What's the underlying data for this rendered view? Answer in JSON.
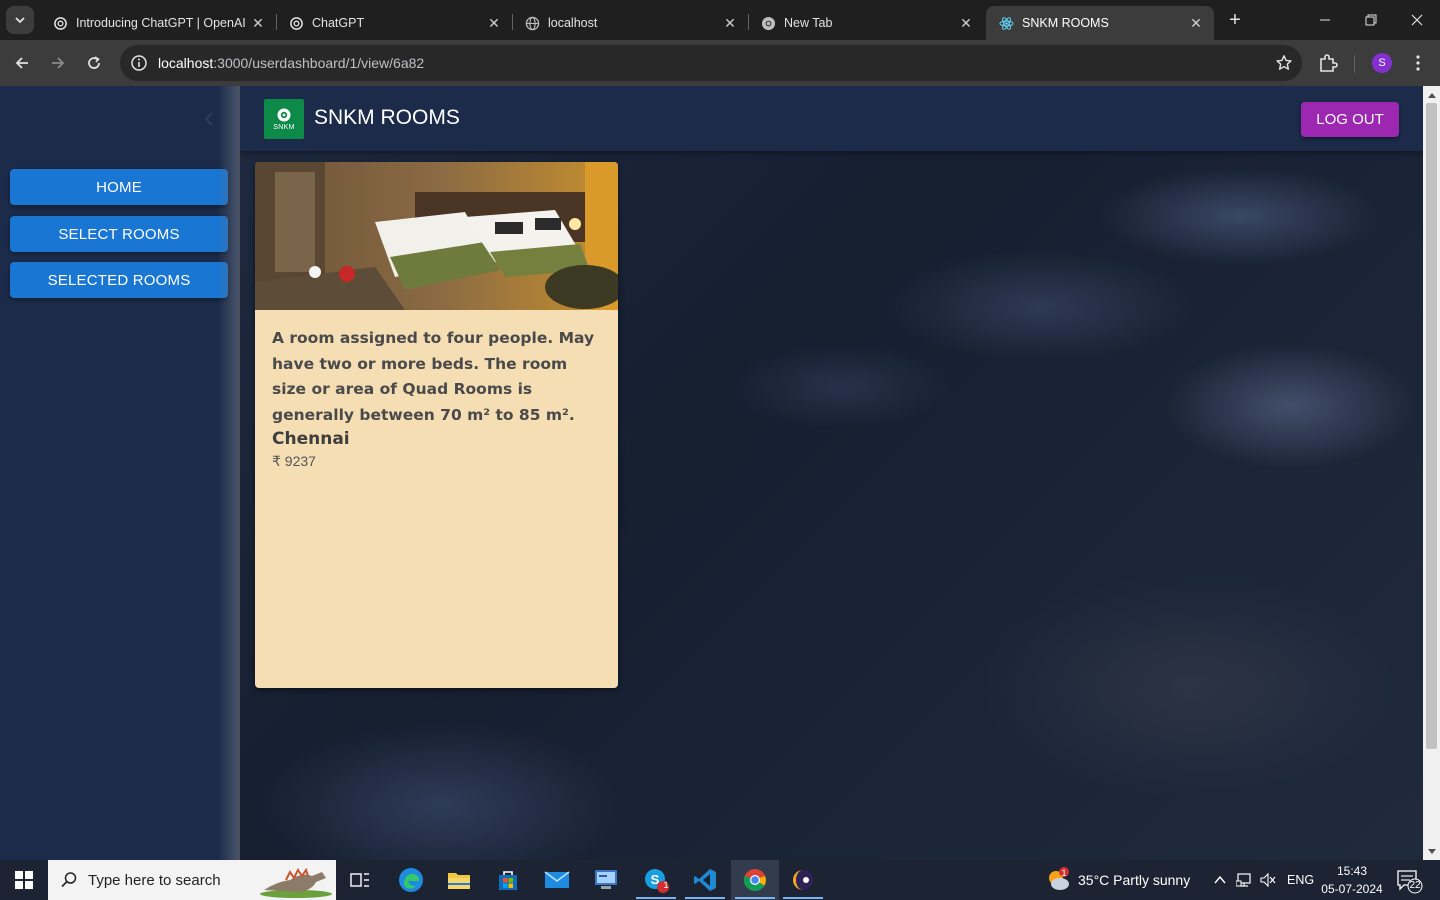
{
  "browser": {
    "tabs": [
      {
        "title": "Introducing ChatGPT | OpenAI",
        "favicon": "openai-icon",
        "active": false
      },
      {
        "title": "ChatGPT",
        "favicon": "openai-icon",
        "active": false
      },
      {
        "title": "localhost",
        "favicon": "globe-icon",
        "active": false
      },
      {
        "title": "New Tab",
        "favicon": "chrome-icon",
        "active": false
      },
      {
        "title": "SNKM ROOMS",
        "favicon": "react-icon",
        "active": true
      }
    ],
    "close_glyph": "✕",
    "new_tab_glyph": "+",
    "url": {
      "host": "localhost",
      "path": ":3000/userdashboard/1/view/6a82"
    },
    "profile_initial": "S",
    "accent_color": "#8430ce"
  },
  "app": {
    "brand": "SNKM ROOMS",
    "logo_text": "SNKM",
    "logout_label": "LOG OUT",
    "sidebar": {
      "items": [
        {
          "label": "HOME"
        },
        {
          "label": "SELECT ROOMS"
        },
        {
          "label": "SELECTED ROOMS"
        }
      ]
    },
    "room": {
      "description": "A room assigned to four people. May have two or more beds. The room size or area of Quad Rooms is generally between 70 m² to 85 m².",
      "city": "Chennai",
      "price": "₹ 9237"
    },
    "colors": {
      "sidebar_bg": "#1b2b49",
      "primary_button": "#1976d2",
      "logout_button": "#9c27b0",
      "card_bg": "#f5deb3",
      "logo_bg": "#0d8a47"
    }
  },
  "taskbar": {
    "search_placeholder": "Type here to search",
    "weather": "35°C  Partly sunny",
    "weather_badge": "1",
    "language": "ENG",
    "time": "15:43",
    "date": "05-07-2024",
    "notification_count": "22",
    "skype_badge": "1"
  }
}
